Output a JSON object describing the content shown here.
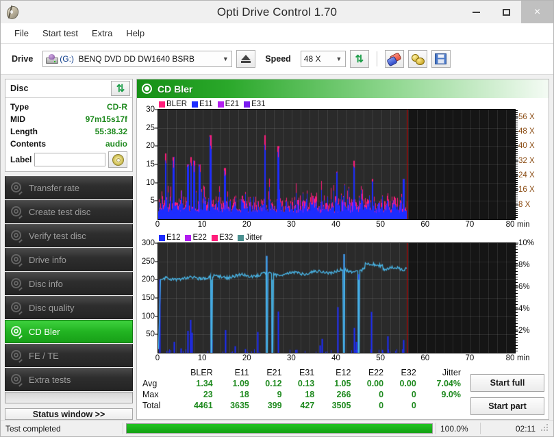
{
  "window": {
    "title": "Opti Drive Control 1.70",
    "app_icon": "disc-icon",
    "minimize": "–",
    "maximize": "□",
    "close": "×"
  },
  "menu": [
    "File",
    "Start test",
    "Extra",
    "Help"
  ],
  "toolbar": {
    "drive_label": "Drive",
    "drive_letter": "(G:)",
    "drive_value": "BENQ DVD DD DW1640 BSRB",
    "eject_icon": "eject-icon",
    "speed_label": "Speed",
    "speed_value": "48 X",
    "refresh_icon": "swap-arrows-icon",
    "erase_icon": "eraser-icon",
    "gold_icon": "coins-icon",
    "save_icon": "floppy-save-icon"
  },
  "disc_panel": {
    "title": "Disc",
    "refresh_icon": "swap-arrows-icon",
    "rows": [
      {
        "key": "Type",
        "value": "CD-R"
      },
      {
        "key": "MID",
        "value": "97m15s17f"
      },
      {
        "key": "Length",
        "value": "55:38.32"
      },
      {
        "key": "Contents",
        "value": "audio"
      }
    ],
    "label_key": "Label",
    "label_value": "",
    "label_placeholder": "",
    "label_button_icon": "cd-disc-icon"
  },
  "nav": {
    "items": [
      {
        "label": "Transfer rate",
        "icon": "disc-icon",
        "active": false
      },
      {
        "label": "Create test disc",
        "icon": "disc-icon",
        "active": false
      },
      {
        "label": "Verify test disc",
        "icon": "disc-icon",
        "active": false
      },
      {
        "label": "Drive info",
        "icon": "disc-icon",
        "active": false
      },
      {
        "label": "Disc info",
        "icon": "disc-icon",
        "active": false
      },
      {
        "label": "Disc quality",
        "icon": "disc-icon",
        "active": false
      },
      {
        "label": "CD Bler",
        "icon": "disc-icon",
        "active": true
      },
      {
        "label": "FE / TE",
        "icon": "disc-icon",
        "active": false
      },
      {
        "label": "Extra tests",
        "icon": "disc-icon",
        "active": false
      }
    ],
    "status_button": "Status window >>"
  },
  "panel": {
    "title": "CD Bler",
    "icon": "disc-icon"
  },
  "stats": {
    "columns": [
      "BLER",
      "E11",
      "E21",
      "E31",
      "E12",
      "E22",
      "E32",
      "Jitter"
    ],
    "rows": [
      {
        "name": "Avg",
        "values": [
          "1.34",
          "1.09",
          "0.12",
          "0.13",
          "1.05",
          "0.00",
          "0.00",
          "7.04%"
        ]
      },
      {
        "name": "Max",
        "values": [
          "23",
          "18",
          "9",
          "18",
          "266",
          "0",
          "0",
          "9.0%"
        ]
      },
      {
        "name": "Total",
        "values": [
          "4461",
          "3635",
          "399",
          "427",
          "3505",
          "0",
          "0",
          ""
        ]
      }
    ],
    "start_full": "Start full",
    "start_part": "Start part"
  },
  "statusbar": {
    "text": "Test completed",
    "percent_label": "100.0%",
    "percent_value": 100,
    "time": "02:11"
  },
  "colors": {
    "bler": "#ff1d7a",
    "e11": "#1d2dff",
    "e21": "#b21df0",
    "e31": "#7a1df0",
    "e12": "#1d2dff",
    "e22": "#b21df0",
    "e32": "#ff1d7a",
    "jitter": "#4a8f8f",
    "jitter_line": "#49b6e8",
    "cursor": "#ee1111",
    "accent_green": "#1fa81f",
    "value_green": "#1f8a1f",
    "right_axis": "#8a4b12",
    "plot_bg": "#2a2a2a"
  },
  "chart_data": [
    {
      "type": "line",
      "name": "CD Bler upper",
      "title": "",
      "xlabel": "min",
      "ylabel": "",
      "xlim": [
        0,
        80
      ],
      "ylim": [
        0,
        30
      ],
      "xticks": [
        0,
        10,
        20,
        30,
        40,
        50,
        60,
        70,
        80
      ],
      "yticks": [
        5,
        10,
        15,
        20,
        25,
        30
      ],
      "right_axis": {
        "label": "X",
        "ylim": [
          0,
          60
        ],
        "ticks": [
          "8 X",
          "16 X",
          "24 X",
          "32 X",
          "40 X",
          "48 X",
          "56 X"
        ],
        "tick_values": [
          8,
          16,
          24,
          32,
          40,
          48,
          56
        ]
      },
      "data_end_x": 55.8,
      "cursor_x": 55.8,
      "grid": true,
      "legend": [
        "BLER",
        "E11",
        "E21",
        "E31"
      ],
      "legend_position": "top-left",
      "series": [
        {
          "name": "BLER",
          "color": "#ff1d7a",
          "avg": 1.34,
          "max": 23,
          "total": 4461
        },
        {
          "name": "E11",
          "color": "#1d2dff",
          "avg": 1.09,
          "max": 18,
          "total": 3635
        },
        {
          "name": "E21",
          "color": "#b21df0",
          "avg": 0.12,
          "max": 9,
          "total": 399
        },
        {
          "name": "E31",
          "color": "#7a1df0",
          "avg": 0.13,
          "max": 18,
          "total": 427
        }
      ],
      "peaks": [
        {
          "x": 1.6,
          "y": 18
        },
        {
          "x": 3.4,
          "y": 17
        },
        {
          "x": 6.6,
          "y": 15
        },
        {
          "x": 7.3,
          "y": 17
        },
        {
          "x": 8.0,
          "y": 16
        },
        {
          "x": 9.2,
          "y": 15
        },
        {
          "x": 11.7,
          "y": 23
        },
        {
          "x": 14.9,
          "y": 14
        },
        {
          "x": 23.9,
          "y": 23
        },
        {
          "x": 26.9,
          "y": 20
        },
        {
          "x": 40.0,
          "y": 13
        },
        {
          "x": 43.8,
          "y": 16
        },
        {
          "x": 48.0,
          "y": 11
        },
        {
          "x": 55.0,
          "y": 11
        }
      ]
    },
    {
      "type": "line",
      "name": "CD Bler lower",
      "title": "",
      "xlabel": "min",
      "ylabel": "",
      "xlim": [
        0,
        80
      ],
      "ylim": [
        0,
        300
      ],
      "xticks": [
        0,
        10,
        20,
        30,
        40,
        50,
        60,
        70,
        80
      ],
      "yticks": [
        50,
        100,
        150,
        200,
        250,
        300
      ],
      "right_axis": {
        "label": "%",
        "ylim": [
          0,
          10
        ],
        "ticks": [
          "2%",
          "4%",
          "6%",
          "8%",
          "10%"
        ],
        "tick_values": [
          2,
          4,
          6,
          8,
          10
        ]
      },
      "data_end_x": 55.8,
      "cursor_x": 55.8,
      "grid": true,
      "legend": [
        "E12",
        "E22",
        "E32",
        "Jitter"
      ],
      "legend_position": "top-left",
      "series": [
        {
          "name": "E12",
          "color": "#1d2dff",
          "avg": 1.05,
          "max": 266,
          "total": 3505
        },
        {
          "name": "E22",
          "color": "#b21df0",
          "avg": 0.0,
          "max": 0,
          "total": 0
        },
        {
          "name": "E32",
          "color": "#ff1d7a",
          "avg": 0.0,
          "max": 0,
          "total": 0
        },
        {
          "name": "Jitter",
          "color": "#4a8f8f",
          "avg": "7.04%",
          "max": "9.0%",
          "total": ""
        }
      ],
      "jitter_trace_note": "Jitter trace ~6.7% rising to ~7.9% across the disc (200-240 on left scale)",
      "e12_spikes": [
        {
          "x": 0.3,
          "y": 200
        },
        {
          "x": 3.5,
          "y": 30
        },
        {
          "x": 5.0,
          "y": 12
        },
        {
          "x": 6.6,
          "y": 60
        },
        {
          "x": 7.2,
          "y": 90
        },
        {
          "x": 7.6,
          "y": 55
        },
        {
          "x": 11.9,
          "y": 190
        },
        {
          "x": 12.0,
          "y": 36
        },
        {
          "x": 15.0,
          "y": 62
        },
        {
          "x": 17.2,
          "y": 18
        },
        {
          "x": 19.5,
          "y": 10
        },
        {
          "x": 22.2,
          "y": 57
        },
        {
          "x": 24.3,
          "y": 265
        },
        {
          "x": 25.5,
          "y": 95
        },
        {
          "x": 26.9,
          "y": 113
        },
        {
          "x": 31.0,
          "y": 8
        },
        {
          "x": 36.3,
          "y": 20
        },
        {
          "x": 36.7,
          "y": 38
        },
        {
          "x": 40.2,
          "y": 125
        },
        {
          "x": 41.6,
          "y": 270
        },
        {
          "x": 43.9,
          "y": 68
        },
        {
          "x": 44.3,
          "y": 30
        },
        {
          "x": 44.9,
          "y": 215
        },
        {
          "x": 47.7,
          "y": 112
        },
        {
          "x": 50.2,
          "y": 8
        },
        {
          "x": 51.4,
          "y": 45
        },
        {
          "x": 54.9,
          "y": 35
        }
      ]
    }
  ]
}
